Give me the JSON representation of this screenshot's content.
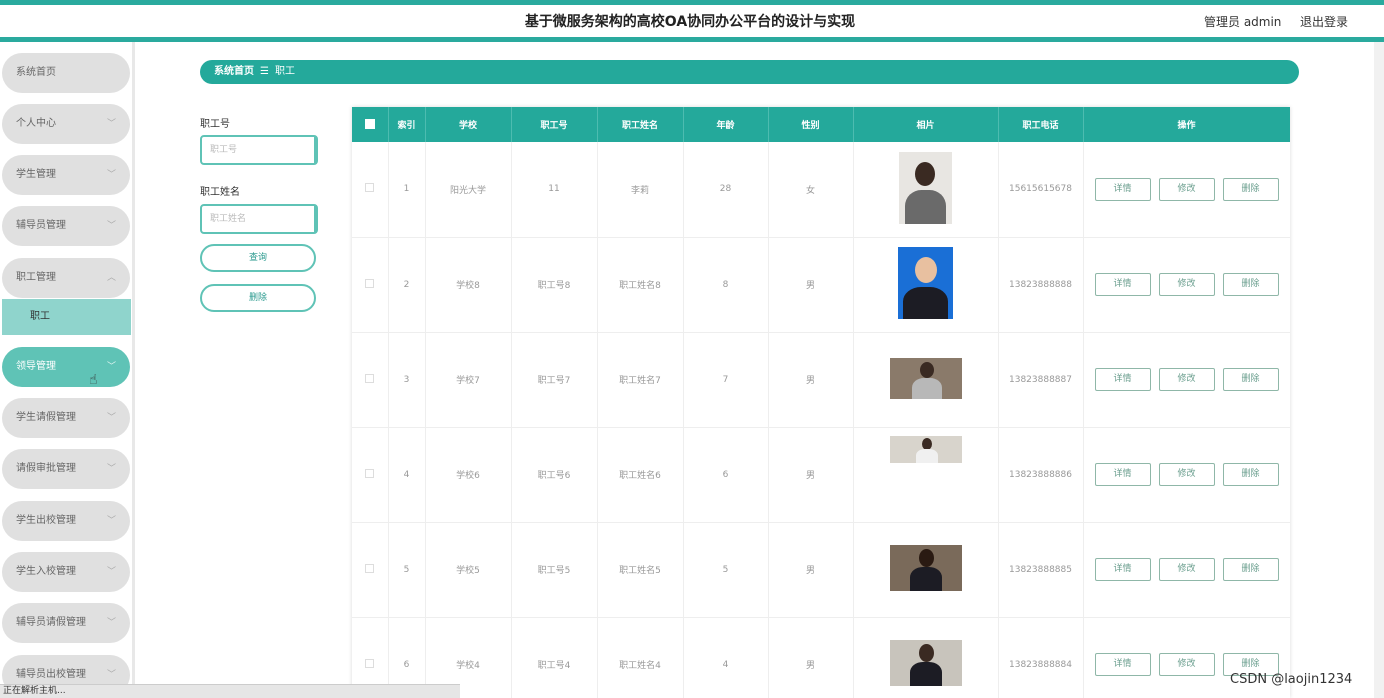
{
  "header": {
    "title": "基于微服务架构的高校OA协同办公平台的设计与实现",
    "admin": "管理员 admin",
    "logout": "退出登录"
  },
  "sidebar": {
    "items": [
      {
        "label": "系统首页"
      },
      {
        "label": "个人中心"
      },
      {
        "label": "学生管理"
      },
      {
        "label": "辅导员管理"
      },
      {
        "label": "职工管理"
      },
      {
        "label": "领导管理"
      },
      {
        "label": "学生请假管理"
      },
      {
        "label": "请假审批管理"
      },
      {
        "label": "学生出校管理"
      },
      {
        "label": "学生入校管理"
      },
      {
        "label": "辅导员请假管理"
      },
      {
        "label": "辅导员出校管理"
      }
    ],
    "sub_item": "职工"
  },
  "breadcrumb": {
    "home": "系统首页",
    "sep": "☰",
    "current": "职工"
  },
  "search": {
    "id_label": "职工号",
    "id_placeholder": "职工号",
    "name_label": "职工姓名",
    "name_placeholder": "职工姓名",
    "query_btn": "查询",
    "delete_btn": "删除"
  },
  "table": {
    "headers": [
      "索引",
      "学校",
      "职工号",
      "职工姓名",
      "年龄",
      "性别",
      "相片",
      "职工电话",
      "操作"
    ],
    "actions": [
      "详情",
      "修改",
      "删除"
    ],
    "rows": [
      {
        "index": "1",
        "school": "阳光大学",
        "id": "11",
        "name": "李莉",
        "age": "28",
        "gender": "女",
        "phone": "15615615678"
      },
      {
        "index": "2",
        "school": "学校8",
        "id": "职工号8",
        "name": "职工姓名8",
        "age": "8",
        "gender": "男",
        "phone": "13823888888"
      },
      {
        "index": "3",
        "school": "学校7",
        "id": "职工号7",
        "name": "职工姓名7",
        "age": "7",
        "gender": "男",
        "phone": "13823888887"
      },
      {
        "index": "4",
        "school": "学校6",
        "id": "职工号6",
        "name": "职工姓名6",
        "age": "6",
        "gender": "男",
        "phone": "13823888886"
      },
      {
        "index": "5",
        "school": "学校5",
        "id": "职工号5",
        "name": "职工姓名5",
        "age": "5",
        "gender": "男",
        "phone": "13823888885"
      },
      {
        "index": "6",
        "school": "学校4",
        "id": "职工号4",
        "name": "职工姓名4",
        "age": "4",
        "gender": "男",
        "phone": "13823888884"
      }
    ]
  },
  "status_bar": "正在解析主机...",
  "watermark": "CSDN @laojin1234",
  "colors": {
    "accent": "#24a99b",
    "active_menu": "#5fc3b6",
    "sub_menu": "#8fd4cc"
  }
}
